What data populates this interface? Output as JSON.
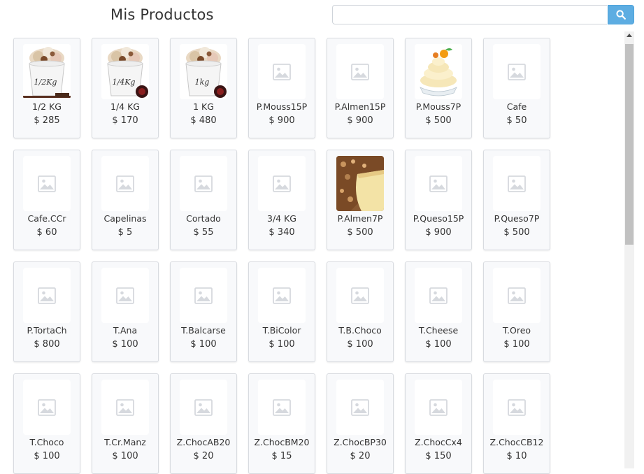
{
  "header": {
    "title": "Mis Productos"
  },
  "search": {
    "placeholder": "",
    "value": "",
    "icon": "search-icon",
    "button_color": "#5dade2"
  },
  "products": [
    {
      "name": "1/2 KG",
      "price": "$ 285",
      "image": "ice-cream-half-kg"
    },
    {
      "name": "1/4 KG",
      "price": "$ 170",
      "image": "ice-cream-quarter-kg"
    },
    {
      "name": "1 KG",
      "price": "$ 480",
      "image": "ice-cream-one-kg"
    },
    {
      "name": "P.Mouss15P",
      "price": "$ 900",
      "image": "placeholder"
    },
    {
      "name": "P.Almen15P",
      "price": "$ 900",
      "image": "placeholder"
    },
    {
      "name": "P.Mouss7P",
      "price": "$ 500",
      "image": "mousse-dessert"
    },
    {
      "name": "Cafe",
      "price": "$ 50",
      "image": "placeholder"
    },
    {
      "name": "Cafe.CCr",
      "price": "$ 60",
      "image": "placeholder"
    },
    {
      "name": "Capelinas",
      "price": "$ 5",
      "image": "placeholder"
    },
    {
      "name": "Cortado",
      "price": "$ 55",
      "image": "placeholder"
    },
    {
      "name": "3/4 KG",
      "price": "$ 340",
      "image": "placeholder"
    },
    {
      "name": "P.Almen7P",
      "price": "$ 500",
      "image": "almond-cake"
    },
    {
      "name": "P.Queso15P",
      "price": "$ 900",
      "image": "placeholder"
    },
    {
      "name": "P.Queso7P",
      "price": "$ 500",
      "image": "placeholder"
    },
    {
      "name": "P.TortaCh",
      "price": "$ 800",
      "image": "placeholder"
    },
    {
      "name": "T.Ana",
      "price": "$ 100",
      "image": "placeholder"
    },
    {
      "name": "T.Balcarse",
      "price": "$ 100",
      "image": "placeholder"
    },
    {
      "name": "T.BiColor",
      "price": "$ 100",
      "image": "placeholder"
    },
    {
      "name": "T.B.Choco",
      "price": "$ 100",
      "image": "placeholder"
    },
    {
      "name": "T.Cheese",
      "price": "$ 100",
      "image": "placeholder"
    },
    {
      "name": "T.Oreo",
      "price": "$ 100",
      "image": "placeholder"
    },
    {
      "name": "T.Choco",
      "price": "$ 100",
      "image": "placeholder"
    },
    {
      "name": "T.Cr.Manz",
      "price": "$ 100",
      "image": "placeholder"
    },
    {
      "name": "Z.ChocAB20",
      "price": "$ 20",
      "image": "placeholder"
    },
    {
      "name": "Z.ChocBM20",
      "price": "$ 15",
      "image": "placeholder"
    },
    {
      "name": "Z.ChocBP30",
      "price": "$ 20",
      "image": "placeholder"
    },
    {
      "name": "Z.ChocCx4",
      "price": "$ 150",
      "image": "placeholder"
    },
    {
      "name": "Z.ChocCB12",
      "price": "$ 10",
      "image": "placeholder"
    }
  ],
  "tub_labels": {
    "half": "1/2Kg",
    "quarter": "1/4Kg",
    "one": "1kg"
  }
}
